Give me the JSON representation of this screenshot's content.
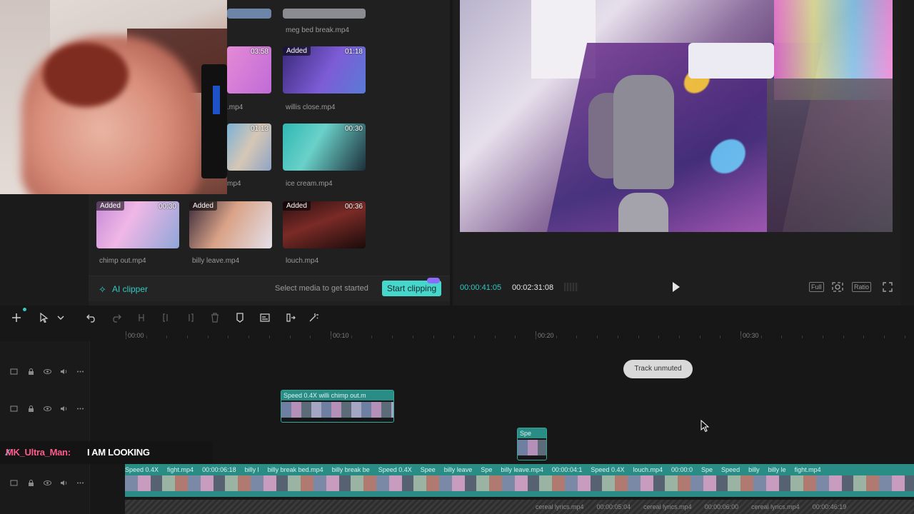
{
  "media": {
    "top_items": [
      {
        "name": "meg bed break.mp4",
        "added": false,
        "duration": ""
      },
      {
        "name": ".mp4",
        "added": false,
        "duration": "03:58"
      },
      {
        "name": "willis close.mp4",
        "added": true,
        "duration": "01:18"
      },
      {
        "name": "mp4",
        "added": false,
        "duration": "01:13"
      },
      {
        "name": "ice cream.mp4",
        "added": false,
        "duration": "00:30"
      }
    ],
    "bottom_items": [
      {
        "name": "chimp out.mp4",
        "added": true,
        "duration": "00:30"
      },
      {
        "name": "billy leave.mp4",
        "added": true,
        "duration": ""
      },
      {
        "name": "louch.mp4",
        "added": true,
        "duration": "00:36"
      }
    ],
    "added_label": "Added",
    "ai_clipper_label": "AI clipper",
    "select_hint": "Select media to get started",
    "start_clipping_label": "Start clipping"
  },
  "player": {
    "current_time": "00:00:41:05",
    "total_time": "00:02:31:08",
    "controls": [
      "Full",
      "Ratio"
    ]
  },
  "timeline": {
    "ruler": [
      "00:00",
      "00:10",
      "00:20",
      "00:30"
    ],
    "toast": "Track unmuted",
    "overlay_clips": [
      {
        "labels": [
          "Speed 0.4X",
          "willi",
          "chimp out.m"
        ]
      },
      {
        "labels": [
          "Spe"
        ]
      }
    ],
    "main_track_labels": [
      "Speed 0.4X",
      "fight.mp4",
      "00:00:06:18",
      "billy l",
      "billy break bed.mp4",
      "billy break be",
      "Speed 0.4X",
      "Spee",
      "billy leave",
      "Spe",
      "billy leave.mp4",
      "00:00:04:1",
      "Speed 0.4X",
      "louch.mp4",
      "00:00:0",
      "Spe",
      "Speed",
      "billy",
      "billy le",
      "fight.mp4"
    ],
    "audio_labels": [
      "cereal lyrics.mp4",
      "00:00:05:04",
      "cereal lyrics.mp4",
      "00:00:06:00",
      "cereal lyrics.mp4",
      "00:00:46:19"
    ]
  },
  "chat": {
    "username": "MK_Ultra_Man:",
    "message": "I AM LOOKING"
  },
  "colors": {
    "accent": "#35c9c0",
    "clip_teal": "#2a8d85",
    "chat_user": "#ff5b8a"
  }
}
